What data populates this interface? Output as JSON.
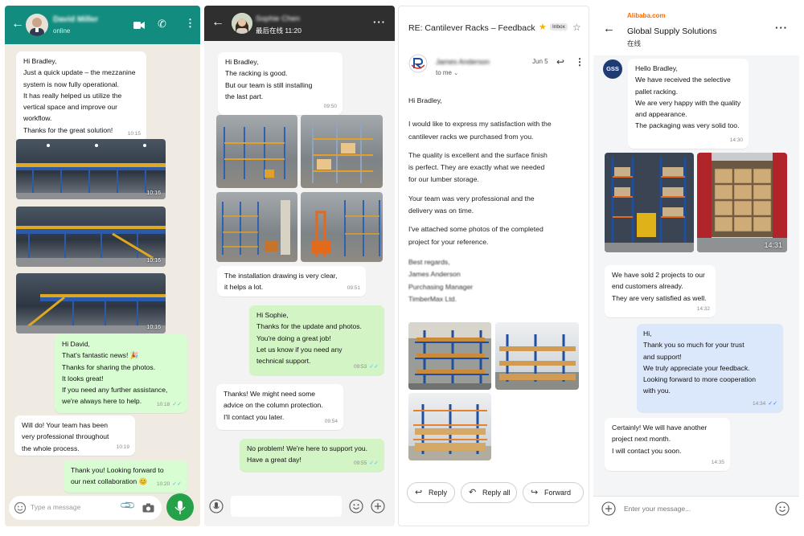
{
  "p1": {
    "contact_name": "David Miller",
    "status": "online",
    "messages": [
      {
        "lines": [
          "Hi Bradley,",
          "Just a quick update – the mezzanine",
          "system is now fully operational.",
          "It has really helped us utilize the",
          "vertical space and improve our",
          "workflow.",
          "Thanks for the great solution!"
        ],
        "time": "10:15"
      },
      {
        "lines": [
          "Hi David,",
          "That's fantastic news! 🎉",
          "Thanks for sharing the photos.",
          "It looks great!",
          "If you need any further assistance,",
          "we're always here to help."
        ],
        "time": "10:18"
      },
      {
        "lines": [
          "Will do! Your team has been",
          "very professional throughout",
          "the whole process."
        ],
        "time": "10:19"
      },
      {
        "lines": [
          "Thank you! Looking forward to",
          "our next collaboration 😊"
        ],
        "time": "10:20"
      }
    ],
    "photo_times": [
      "10:16",
      "10:16",
      "10:16"
    ],
    "input_placeholder": "Type a message"
  },
  "p2": {
    "contact_name": "Sophie Chen",
    "status": "最后在线 11:20",
    "messages": [
      {
        "lines": [
          "Hi Bradley,",
          "The racking is good.",
          "But our team is still installing",
          "the last part."
        ],
        "time": "09:50"
      },
      {
        "lines": [
          "The installation drawing is very clear,",
          "it helps a lot."
        ],
        "time": "09:51"
      },
      {
        "lines": [
          "Hi Sophie,",
          "Thanks for the update and photos.",
          "You're doing a great job!",
          "Let us know if you need any",
          "technical support."
        ],
        "time": "09:53"
      },
      {
        "lines": [
          "Thanks! We might need some",
          "advice on the column protection.",
          "I'll contact you later."
        ],
        "time": "09:54"
      },
      {
        "lines": [
          "No problem! We're here to support you.",
          "Have a great day!"
        ],
        "time": "09:55"
      }
    ]
  },
  "p3": {
    "subject": "RE: Cantilever Racks – Feedback",
    "inbox_label": "Inbox",
    "sender": "James Anderson",
    "date": "Jun 5",
    "to_me": "to me",
    "paragraphs": [
      [
        "Hi Bradley,"
      ],
      [
        "I would like to express my satisfaction with the",
        "cantilever racks we purchased from you."
      ],
      [
        "The quality is excellent and the surface finish",
        "is perfect. They are exactly what we needed",
        "for our lumber storage."
      ],
      [
        "Your team was very professional and the",
        "delivery was on time."
      ],
      [
        "I've attached some photos of the completed",
        "project for your reference."
      ]
    ],
    "signature": [
      "Best regards,",
      "James Anderson",
      "Purchasing Manager",
      "TimberMax Ltd."
    ],
    "buttons": {
      "reply": "Reply",
      "reply_all": "Reply all",
      "forward": "Forward"
    }
  },
  "p4": {
    "brand": "Alibaba.com",
    "title": "Global Supply Solutions",
    "status": "在线",
    "avatar": "GSS",
    "messages": [
      {
        "lines": [
          "Hello Bradley,",
          "We have received the selective",
          "pallet racking.",
          "We are very happy with the quality",
          "and appearance.",
          "The packaging was very solid too."
        ],
        "time": "14:30"
      },
      {
        "lines": [
          "We have sold 2 projects to our",
          "end customers already.",
          "They are very satisfied as well."
        ],
        "time": "14:32"
      },
      {
        "lines": [
          "Hi,",
          "Thank you so much for your trust",
          "and support!",
          "We truly appreciate your feedback.",
          "Looking forward to more cooperation",
          "with you."
        ],
        "time": "14:34"
      },
      {
        "lines": [
          "Certainly! We will have another",
          "project next month.",
          "I will contact you soon."
        ],
        "time": "14:35"
      }
    ],
    "photo_time": "14:31",
    "input_placeholder": "Enter your message..."
  },
  "colors": {
    "whatsapp_green": "#128c7e",
    "mic_green": "#25a14a",
    "tick_blue": "#53bdeb",
    "alibaba_orange": "#ff6a00"
  }
}
